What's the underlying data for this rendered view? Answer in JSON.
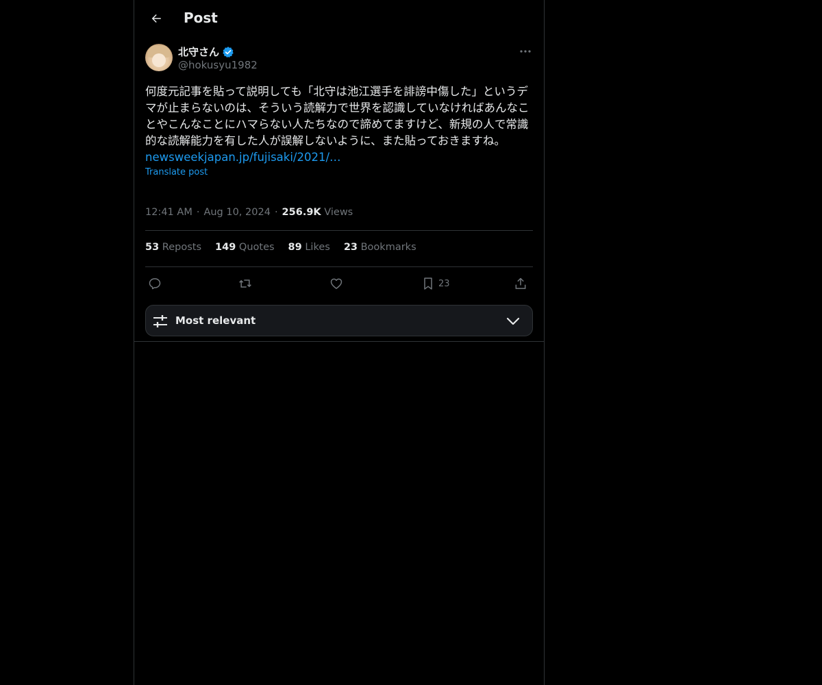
{
  "header": {
    "title": "Post"
  },
  "author": {
    "name": "北守さん",
    "handle": "@hokusyu1982"
  },
  "post": {
    "text": "何度元記事を貼って説明しても「北守は池江選手を誹謗中傷した」というデマが止まらないのは、そういう読解力で世界を認識していなければあんなことやこんなことにハマらない人たちなので諦めてますけど、新規の人で常識的な読解能力を有した人が誤解しないように、また貼っておきますね。",
    "link": "newsweekjapan.jp/fujisaki/2021/…",
    "translate_label": "Translate post"
  },
  "meta": {
    "time": "12:41 AM",
    "date": "Aug 10, 2024",
    "views_count": "256.9K",
    "views_label": "Views",
    "sep": "·"
  },
  "stats": {
    "reposts_count": "53",
    "reposts_label": "Reposts",
    "quotes_count": "149",
    "quotes_label": "Quotes",
    "likes_count": "89",
    "likes_label": "Likes",
    "bookmarks_count": "23",
    "bookmarks_label": "Bookmarks"
  },
  "actions": {
    "bookmark_count": "23"
  },
  "sort": {
    "label": "Most relevant"
  },
  "colors": {
    "accent": "#1d9bf0",
    "background": "#000000",
    "text": "#e7e9ea",
    "muted": "#71767b",
    "border": "#2f3336"
  },
  "icons": [
    "back-arrow-icon",
    "verified-badge-icon",
    "more-icon",
    "reply-icon",
    "repost-icon",
    "like-icon",
    "bookmark-icon",
    "share-icon",
    "sliders-icon",
    "chevron-down-icon"
  ]
}
